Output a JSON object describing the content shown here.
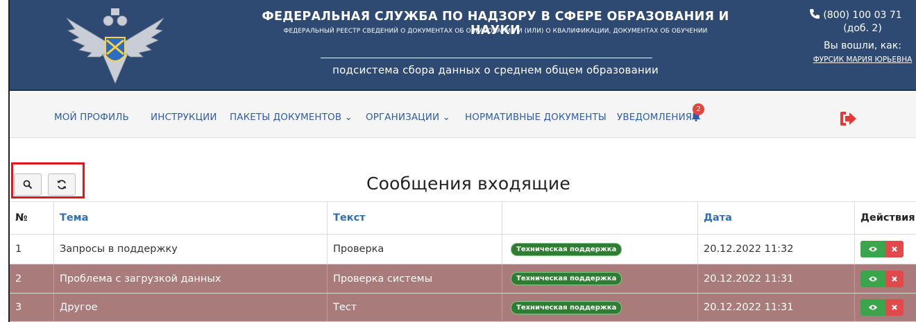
{
  "header": {
    "title": "ФЕДЕРАЛЬНАЯ СЛУЖБА ПО НАДЗОРУ В СФЕРЕ ОБРАЗОВАНИЯ И НАУКИ",
    "subtitle": "ФЕДЕРАЛЬНЫЙ РЕЕСТР СВЕДЕНИЙ О ДОКУМЕНТАХ ОБ ОБРАЗОВАНИИ И (ИЛИ) О КВАЛИФИКАЦИИ, ДОКУМЕНТАХ ОБ ОБУЧЕНИИ",
    "subsystem": "подсистема сбора данных о среднем общем образовании",
    "phone": "(800) 100 03 71",
    "ext": "(доб. 2)",
    "logged_in_as": "Вы вошли, как:",
    "user_name": "ФУРСИК МАРИЯ ЮРЬЕВНА",
    "emblem_icon": "eagle-emblem-icon"
  },
  "nav": {
    "items": [
      {
        "label": "МОЙ ПРОФИЛЬ"
      },
      {
        "label": "ИНСТРУКЦИИ"
      },
      {
        "label": "ПАКЕТЫ ДОКУМЕНТОВ"
      },
      {
        "label": "ОРГАНИЗАЦИИ"
      },
      {
        "label": "НОРМАТИВНЫЕ ДОКУМЕНТЫ"
      },
      {
        "label": "УВЕДОМЛЕНИЯ"
      }
    ],
    "notifications_count": "2",
    "logout_icon": "logout-icon"
  },
  "toolbar": {
    "search_icon": "search-icon",
    "refresh_icon": "refresh-icon"
  },
  "page_title": "Сообщения входящие",
  "table": {
    "columns": [
      "№",
      "Тема",
      "Текст",
      "",
      "Дата",
      "Действия"
    ],
    "rows": [
      {
        "no": "1",
        "theme": "Запросы в поддержку",
        "text": "Проверка",
        "tag": "Техническая поддержка",
        "date": "20.12.2022 11:32"
      },
      {
        "no": "2",
        "theme": "Проблема с загрузкой данных",
        "text": "Проверка системы",
        "tag": "Техническая поддержка",
        "date": "20.12.2022 11:31"
      },
      {
        "no": "3",
        "theme": "Другое",
        "text": "Тест",
        "tag": "Техническая поддержка",
        "date": "20.12.2022 11:31"
      }
    ]
  },
  "colors": {
    "header_bg": "#2e4a73",
    "link": "#2f5da8",
    "unread_row": "#a97b7b",
    "tag_green": "#2e7d32",
    "view_button": "#3aa54b",
    "delete_button": "#e14a4a",
    "highlight": "#e0161c"
  }
}
